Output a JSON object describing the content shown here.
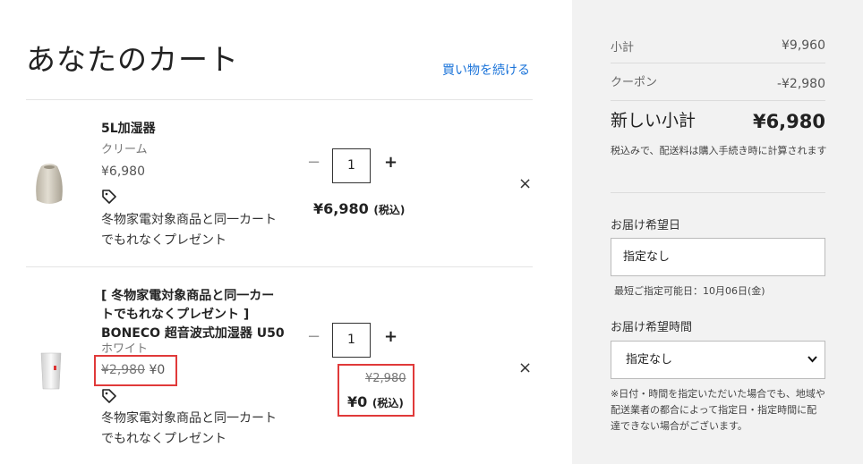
{
  "cart": {
    "title": "あなたのカート",
    "continue_link": "買い物を続ける",
    "items": [
      {
        "name": "5L加湿器",
        "variant": "クリーム",
        "price": "¥6,980",
        "promo": "冬物家電対象商品と同一カートでもれなくプレゼント",
        "quantity": "1",
        "line_total": "¥6,980",
        "tax_label": "(税込)"
      },
      {
        "name_line1": "[ 冬物家電対象商品と同一カー",
        "name_line2": "トでもれなくプレゼント ]",
        "name_line3": "BONECO 超音波式加湿器 U50",
        "variant": "ホワイト",
        "original_price": "¥2,980",
        "sale_price": "¥0",
        "promo": "冬物家電対象商品と同一カートでもれなくプレゼント",
        "quantity": "1",
        "line_original": "¥2,980",
        "line_total": "¥0",
        "tax_label": "(税込)"
      }
    ],
    "qty_minus": "−",
    "qty_plus": "+",
    "remove": "×"
  },
  "summary": {
    "subtotal_label": "小計",
    "subtotal_value": "¥9,960",
    "coupon_label": "クーポン",
    "coupon_value": "-¥2,980",
    "new_subtotal_label": "新しい小計",
    "new_subtotal_value": "¥6,980",
    "tax_note": "税込みで、配送料は購入手続き時に計算されます",
    "delivery_date_label": "お届け希望日",
    "delivery_date_value": "指定なし",
    "delivery_date_helper": "最短ご指定可能日：10月06日(金)",
    "delivery_time_label": "お届け希望時間",
    "delivery_time_value": "指定なし",
    "delivery_note": "※日付・時間を指定いただいた場合でも、地域や配送業者の都合によって指定日・指定時間に配達できない場合がございます。"
  },
  "colors": {
    "link": "#1a73d9",
    "highlight": "#e03a3a",
    "sidebar_bg": "#f2f2f2"
  },
  "icons": {
    "tag": "tag-icon",
    "remove": "close-icon",
    "chevron": "chevron-down-icon"
  }
}
